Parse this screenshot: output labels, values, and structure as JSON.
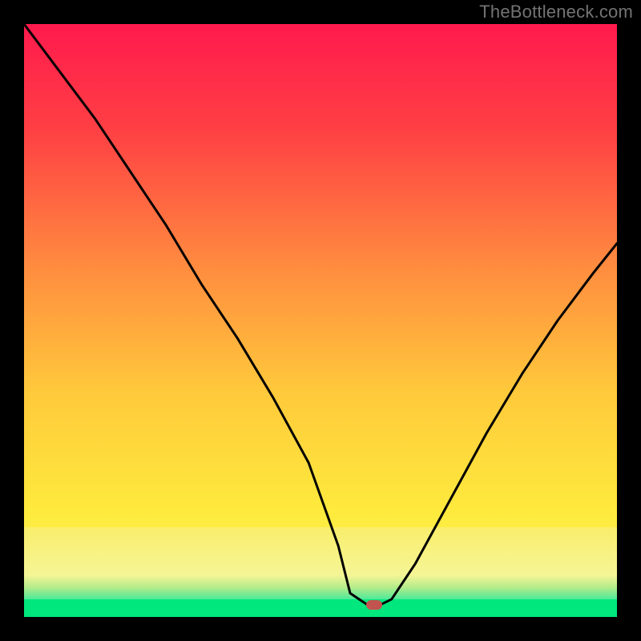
{
  "watermark": "TheBottleneck.com",
  "chart_data": {
    "type": "line",
    "title": "",
    "xlabel": "",
    "ylabel": "",
    "xlim": [
      0,
      100
    ],
    "ylim": [
      0,
      100
    ],
    "grid": false,
    "legend": false,
    "series": [
      {
        "name": "bottleneck-curve",
        "x": [
          0,
          6,
          12,
          18,
          24,
          30,
          36,
          42,
          48,
          53,
          55,
          58,
          60,
          62,
          66,
          72,
          78,
          84,
          90,
          96,
          100
        ],
        "y": [
          100,
          92,
          84,
          75,
          66,
          56,
          47,
          37,
          26,
          12,
          4,
          2,
          2,
          3,
          9,
          20,
          31,
          41,
          50,
          58,
          63
        ]
      }
    ],
    "annotations": [
      {
        "name": "optimal-marker",
        "x": 59,
        "y": 2
      }
    ],
    "background_gradient": {
      "top": "#ff1a4d",
      "mid": "#ffb03a",
      "low": "#feea3c",
      "bottom": "#00e77d"
    }
  }
}
